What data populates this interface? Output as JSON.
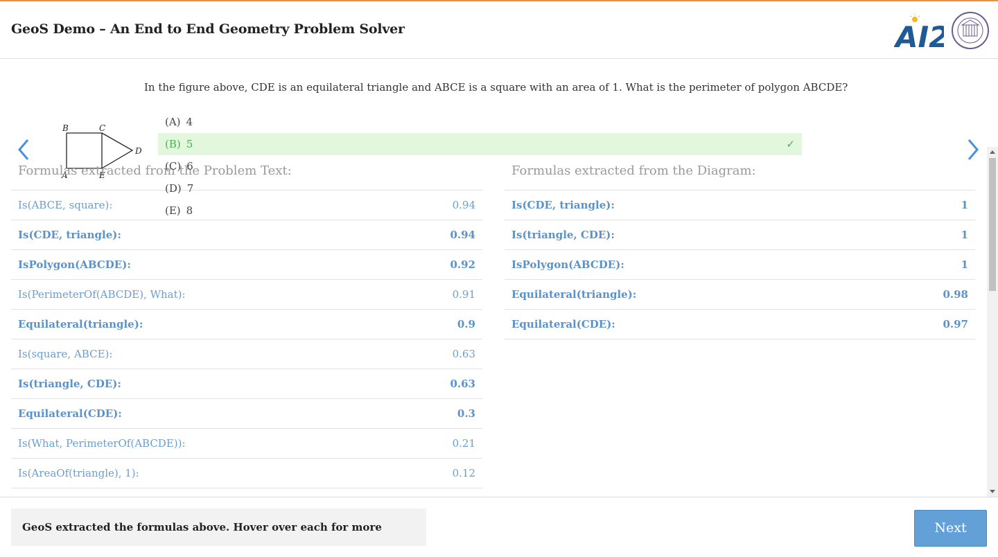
{
  "header": {
    "title": "GeoS Demo – An End to End Geometry Problem Solver",
    "ai2_logo_text": "AI2",
    "seal_text": "UNIVERSITY OF WASHINGTON 1861"
  },
  "question": {
    "text": "In the figure above, CDE is an equilateral triangle and ABCE is a square with an area of 1. What is the perimeter of polygon ABCDE?",
    "diagram_labels": {
      "A": "A",
      "B": "B",
      "C": "C",
      "D": "D",
      "E": "E"
    },
    "choices": [
      {
        "letter": "(A)",
        "value": "4",
        "correct": false
      },
      {
        "letter": "(B)",
        "value": "5",
        "correct": true
      },
      {
        "letter": "(C)",
        "value": "6",
        "correct": false
      },
      {
        "letter": "(D)",
        "value": "7",
        "correct": false
      },
      {
        "letter": "(E)",
        "value": "8",
        "correct": false
      }
    ],
    "check_mark": "✓"
  },
  "text_formulas": {
    "heading": "Formulas extracted from the Problem Text:",
    "rows": [
      {
        "formula": "Is(ABCE, square):",
        "score": "0.94",
        "bold": false
      },
      {
        "formula": "Is(CDE, triangle):",
        "score": "0.94",
        "bold": true
      },
      {
        "formula": "IsPolygon(ABCDE):",
        "score": "0.92",
        "bold": true
      },
      {
        "formula": "Is(PerimeterOf(ABCDE), What):",
        "score": "0.91",
        "bold": false
      },
      {
        "formula": "Equilateral(triangle):",
        "score": "0.9",
        "bold": true
      },
      {
        "formula": "Is(square, ABCE):",
        "score": "0.63",
        "bold": false
      },
      {
        "formula": "Is(triangle, CDE):",
        "score": "0.63",
        "bold": true
      },
      {
        "formula": "Equilateral(CDE):",
        "score": "0.3",
        "bold": true
      },
      {
        "formula": "Is(What, PerimeterOf(ABCDE)):",
        "score": "0.21",
        "bold": false
      },
      {
        "formula": "Is(AreaOf(triangle), 1):",
        "score": "0.12",
        "bold": false
      }
    ]
  },
  "diagram_formulas": {
    "heading": "Formulas extracted from the Diagram:",
    "rows": [
      {
        "formula": "Is(CDE, triangle):",
        "score": "1",
        "bold": true
      },
      {
        "formula": "Is(triangle, CDE):",
        "score": "1",
        "bold": true
      },
      {
        "formula": "IsPolygon(ABCDE):",
        "score": "1",
        "bold": true
      },
      {
        "formula": "Equilateral(triangle):",
        "score": "0.98",
        "bold": true
      },
      {
        "formula": "Equilateral(CDE):",
        "score": "0.97",
        "bold": true
      }
    ]
  },
  "footer": {
    "hint": "GeoS extracted the formulas above. Hover over each for more information.",
    "next_label": "Next"
  },
  "colors": {
    "accent_top": "#e8913b",
    "link_blue": "#6b9ecf",
    "correct_green": "#4caf50",
    "correct_bg": "#e3f7df",
    "button_blue": "#64a0d8"
  }
}
